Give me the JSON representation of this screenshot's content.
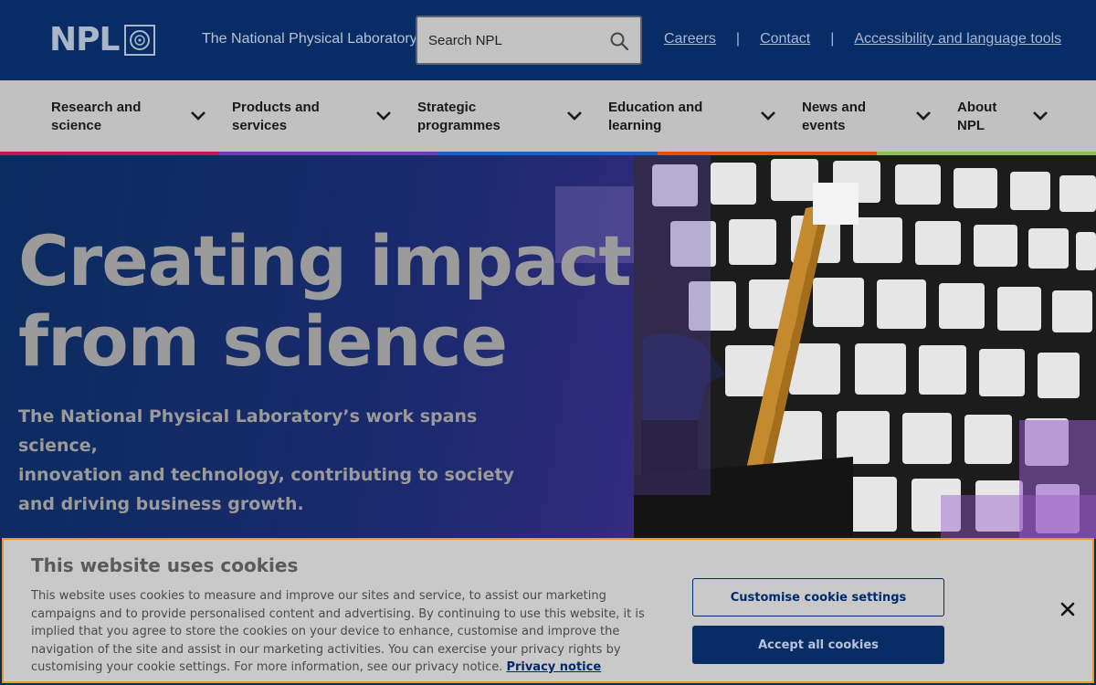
{
  "header": {
    "logo_text": "NPL",
    "tagline": "The National Physical Laboratory",
    "search_placeholder": "Search NPL",
    "links": [
      "Careers",
      "Contact",
      "Accessibility and language tools"
    ]
  },
  "nav": {
    "items": [
      {
        "line1": "Research and",
        "line2": "science"
      },
      {
        "line1": "Products and",
        "line2": "services"
      },
      {
        "line1": "Strategic",
        "line2": "programmes"
      },
      {
        "line1": "Education and",
        "line2": "learning"
      },
      {
        "line1": "News and",
        "line2": "events"
      },
      {
        "line1": "About",
        "line2": "NPL"
      }
    ],
    "stripe_colors": [
      "#c2185b",
      "#6a3fb5",
      "#1565c0",
      "#e65100",
      "#8bc34a"
    ]
  },
  "hero": {
    "headline_line1": "Creating impact",
    "headline_line2": "from science",
    "subtext_line1": "The National Physical Laboratory’s work spans science,",
    "subtext_line2": "innovation and technology, contributing to society",
    "subtext_line3": "and driving business growth."
  },
  "cookie": {
    "title": "This website uses cookies",
    "body": "This website uses cookies to measure and improve our sites and service, to assist our marketing campaigns and to provide personalised content and advertising. By continuing to use this website, it is implied that you agree to store the cookies on your device to enhance, customise and improve the navigation of the site and assist in our marketing activities. You can exercise your privacy rights by customising your cookie settings. For more information, see our privacy notice.",
    "privacy_link": "Privacy notice",
    "customise_label": "Customise cookie settings",
    "accept_label": "Accept all cookies"
  },
  "colors": {
    "header_bg": "#082c66",
    "nav_bg": "#c1c1c1",
    "cookie_border": "#e39b2b",
    "accent_navy": "#002b6b"
  }
}
